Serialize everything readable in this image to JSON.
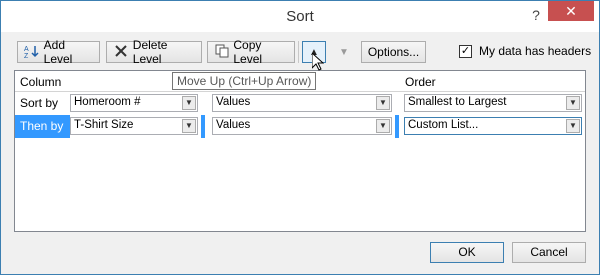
{
  "window": {
    "title": "Sort",
    "help_label": "?",
    "close_label": "✕"
  },
  "toolbar": {
    "add_level": "Add Level",
    "delete_level": "Delete Level",
    "copy_level": "Copy Level",
    "move_up_glyph": "▲",
    "move_down_glyph": "▼",
    "options": "Options...",
    "headers_checkbox": {
      "label": "My data has headers",
      "checked": true,
      "mark": "✓"
    }
  },
  "grid": {
    "headers": {
      "column": "Column",
      "sort_on": "",
      "order": "Order"
    },
    "rows": [
      {
        "label": "Sort by",
        "column": "Homeroom #",
        "sort_on": "Values",
        "order": "Smallest to Largest",
        "selected": false
      },
      {
        "label": "Then by",
        "column": "T-Shirt Size",
        "sort_on": "Values",
        "order": "Custom List...",
        "selected": true
      }
    ]
  },
  "tooltip": {
    "text": "Move Up (Ctrl+Up Arrow)"
  },
  "footer": {
    "ok": "OK",
    "cancel": "Cancel"
  },
  "colors": {
    "selection": "#3399ff",
    "close": "#c75050",
    "accent_border": "#3c7fb1"
  }
}
